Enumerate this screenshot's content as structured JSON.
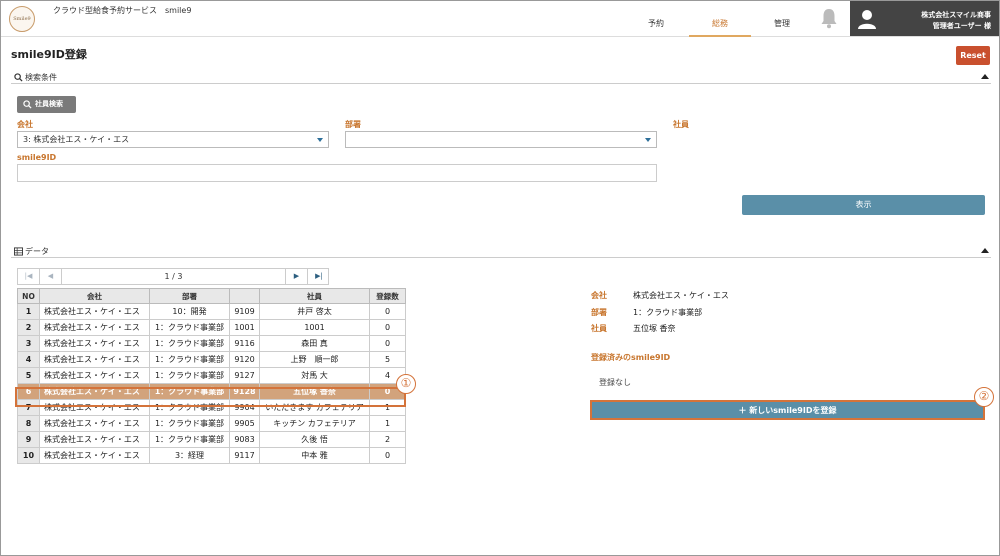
{
  "header": {
    "logo_text": "Smile9",
    "app_title": "クラウド型給食予約サービス　smile9",
    "nav": [
      {
        "label": "予約",
        "active": false
      },
      {
        "label": "総務",
        "active": true
      },
      {
        "label": "管理",
        "active": false
      }
    ],
    "user_company": "株式会社スマイル商事",
    "user_name": "管理者ユーザー 様"
  },
  "page": {
    "title": "smile9ID登録",
    "reset_label": "Reset"
  },
  "search": {
    "section_label": "検索条件",
    "employee_search_label": "社員検索",
    "company_label": "会社",
    "company_value": "3: 株式会社エス・ケイ・エス",
    "department_label": "部署",
    "department_value": "",
    "employee_label": "社員",
    "smile9id_label": "smile9ID",
    "smile9id_value": "",
    "show_label": "表示"
  },
  "data_section": {
    "section_label": "データ",
    "pager": {
      "text": "1 / 3"
    },
    "columns": [
      "NO",
      "会社",
      "部署",
      "",
      "社員",
      "登録数"
    ],
    "rows": [
      {
        "no": "1",
        "company": "株式会社エス・ケイ・エス",
        "dept": "10：開発",
        "code": "9109",
        "name": "井戸 啓太",
        "count": "0"
      },
      {
        "no": "2",
        "company": "株式会社エス・ケイ・エス",
        "dept": "1：クラウド事業部",
        "code": "1001",
        "name": "1001",
        "count": "0"
      },
      {
        "no": "3",
        "company": "株式会社エス・ケイ・エス",
        "dept": "1：クラウド事業部",
        "code": "9116",
        "name": "森田 真",
        "count": "0"
      },
      {
        "no": "4",
        "company": "株式会社エス・ケイ・エス",
        "dept": "1：クラウド事業部",
        "code": "9120",
        "name": "上野　順一郎",
        "count": "5"
      },
      {
        "no": "5",
        "company": "株式会社エス・ケイ・エス",
        "dept": "1：クラウド事業部",
        "code": "9127",
        "name": "対馬 大",
        "count": "4"
      },
      {
        "no": "6",
        "company": "株式会社エス・ケイ・エス",
        "dept": "1：クラウド事業部",
        "code": "9128",
        "name": "五位塚 香奈",
        "count": "0"
      },
      {
        "no": "7",
        "company": "株式会社エス・ケイ・エス",
        "dept": "1：クラウド事業部",
        "code": "9904",
        "name": "いただきます カフェテリア",
        "count": "1"
      },
      {
        "no": "8",
        "company": "株式会社エス・ケイ・エス",
        "dept": "1：クラウド事業部",
        "code": "9905",
        "name": "キッチン カフェテリア",
        "count": "1"
      },
      {
        "no": "9",
        "company": "株式会社エス・ケイ・エス",
        "dept": "1：クラウド事業部",
        "code": "9083",
        "name": "久後 悟",
        "count": "2"
      },
      {
        "no": "10",
        "company": "株式会社エス・ケイ・エス",
        "dept": "3：経理",
        "code": "9117",
        "name": "中本 雅",
        "count": "0"
      }
    ],
    "selected_row": 5
  },
  "detail": {
    "company_label": "会社",
    "company_value": "株式会社エス・ケイ・エス",
    "dept_label": "部署",
    "dept_value": "1：クラウド事業部",
    "employee_label": "社員",
    "employee_value": "五位塚 香奈",
    "registered_label": "登録済みのsmile9ID",
    "registered_none": "登録なし",
    "new_button_label": "＋ 新しいsmile9IDを登録"
  },
  "callouts": [
    "①",
    "②"
  ],
  "colors": {
    "accent": "#c8762e",
    "primary_button": "#5a8fa8",
    "reset_button": "#c9502e",
    "highlight": "#d4733a"
  }
}
